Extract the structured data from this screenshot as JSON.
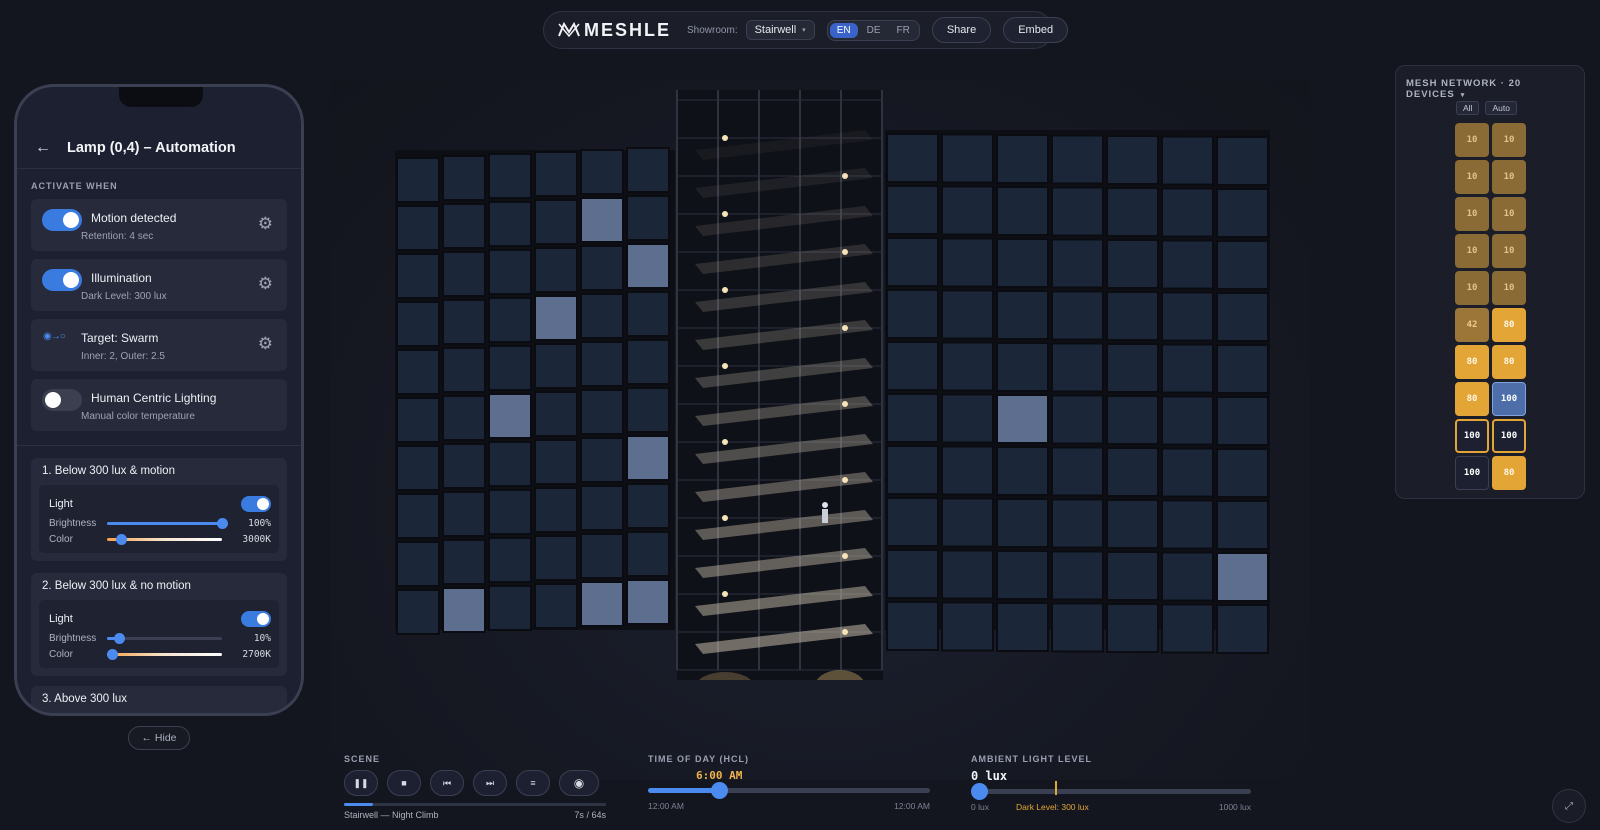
{
  "topbar": {
    "logo_text": "MESHLE",
    "showroom_label": "Showroom:",
    "showroom_value": "Stairwell",
    "languages": [
      "EN",
      "DE",
      "FR"
    ],
    "active_language": "EN",
    "share_label": "Share",
    "embed_label": "Embed"
  },
  "phone": {
    "title": "Lamp (0,4) – Automation",
    "activate_label": "ACTIVATE WHEN",
    "conditions": [
      {
        "title": "Motion detected",
        "subtitle": "Retention: 4 sec",
        "enabled": true
      },
      {
        "title": "Illumination",
        "subtitle": "Dark Level: 300 lux",
        "enabled": true
      },
      {
        "title": "Target: Swarm",
        "subtitle": "Inner: 2, Outer: 2.5"
      },
      {
        "title": "Human Centric Lighting",
        "subtitle": "Manual color temperature",
        "enabled": false
      }
    ],
    "rules": [
      {
        "title": "1. Below 300 lux & motion",
        "light_label": "Light",
        "light_on": true,
        "brightness_label": "Brightness",
        "brightness_value": "100%",
        "brightness_frac": 1.0,
        "color_label": "Color",
        "color_value": "3000K",
        "color_frac": 0.12
      },
      {
        "title": "2. Below 300 lux & no motion",
        "light_label": "Light",
        "light_on": true,
        "brightness_label": "Brightness",
        "brightness_value": "10%",
        "brightness_frac": 0.1,
        "color_label": "Color",
        "color_value": "2700K",
        "color_frac": 0.04
      }
    ],
    "rule3_title": "3. Above 300 lux",
    "hide_label": "← Hide"
  },
  "mesh": {
    "title": "MESH NETWORK · 20 DEVICES",
    "filters": [
      "All",
      "Auto"
    ],
    "devices": [
      {
        "value": "10",
        "state": "dim"
      },
      {
        "value": "10",
        "state": "dim"
      },
      {
        "value": "10",
        "state": "dim"
      },
      {
        "value": "10",
        "state": "dim"
      },
      {
        "value": "10",
        "state": "dim"
      },
      {
        "value": "10",
        "state": "dim"
      },
      {
        "value": "10",
        "state": "dim"
      },
      {
        "value": "10",
        "state": "dim"
      },
      {
        "value": "10",
        "state": "dim"
      },
      {
        "value": "10",
        "state": "dim"
      },
      {
        "value": "42",
        "state": "mid"
      },
      {
        "value": "80",
        "state": "hot"
      },
      {
        "value": "80",
        "state": "hot"
      },
      {
        "value": "80",
        "state": "hot"
      },
      {
        "value": "80",
        "state": "hot"
      },
      {
        "value": "100",
        "state": "blue"
      },
      {
        "value": "100",
        "state": "ring"
      },
      {
        "value": "100",
        "state": "ring"
      },
      {
        "value": "100",
        "state": "dark"
      },
      {
        "value": "80",
        "state": "hot"
      }
    ]
  },
  "scene": {
    "label": "SCENE",
    "buttons": [
      "pause-icon",
      "stop-icon",
      "skip-back-icon",
      "skip-forward-icon",
      "list-icon",
      "eye-icon"
    ],
    "name": "Stairwell — Night Climb",
    "elapsed": "7s",
    "separator": "/",
    "total": "64s",
    "progress_frac": 0.11
  },
  "time_of_day": {
    "label": "TIME OF DAY (HCL)",
    "value": "6:00 AM",
    "frac": 0.25,
    "min_label": "12:00 AM",
    "max_label": "12:00 AM"
  },
  "ambient": {
    "label": "AMBIENT LIGHT LEVEL",
    "value": "0 lux",
    "frac": 0.0,
    "dark_level_label": "Dark Level: 300 lux",
    "dark_level_frac": 0.3,
    "min_label": "0 lux",
    "max_label": "1000 lux"
  },
  "colors": {
    "accent": "#4b8bf0",
    "warm": "#e3a535",
    "background": "#14161f"
  }
}
